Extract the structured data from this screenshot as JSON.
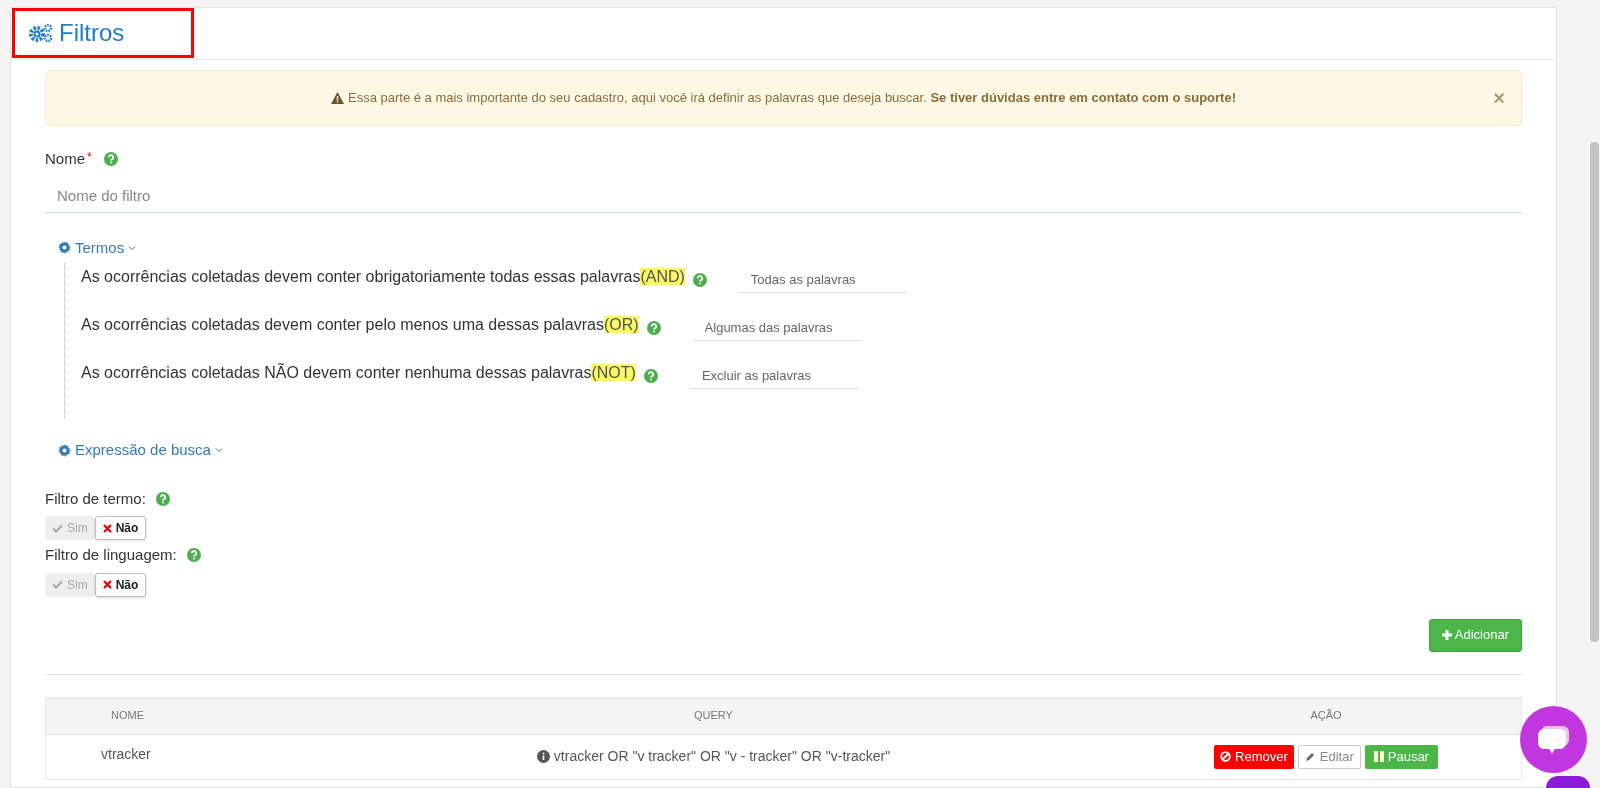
{
  "panel": {
    "title": "Filtros",
    "title_highlighted": true
  },
  "alert": {
    "text": "Essa parte é a mais importante do seu cadastro, aqui você irá definir as palavras que deseja buscar. **Se tiver dúvidas entre em contato com o suporte!**",
    "close": "×"
  },
  "name_field": {
    "label": "Nome",
    "required": "*",
    "placeholder": "Nome do filtro"
  },
  "terms_section": {
    "label": "Termos",
    "expanded": true,
    "rows": [
      {
        "label": "As ocorrências coletadas devem conter obrigatoriamente todas essas palavras",
        "operator": "(AND)",
        "highlighted": true,
        "placeholder": "Todas as palavras"
      },
      {
        "label": "As ocorrências coletadas devem conter pelo menos uma dessas palavras",
        "operator": "(OR)",
        "highlighted": true,
        "placeholder": "Algumas das palavras"
      },
      {
        "label": "As ocorrências coletadas NÃO devem conter nenhuma dessas palavras",
        "operator": "(NOT)",
        "highlighted": true,
        "placeholder": "Excluir as palavras"
      }
    ]
  },
  "expression_section": {
    "label": "Expressão de busca"
  },
  "toggles": [
    {
      "label": "Filtro de termo:",
      "options": [
        {
          "label": "Sim",
          "selected": false
        },
        {
          "label": "Não",
          "selected": true
        }
      ]
    },
    {
      "label": "Filtro de linguagem:",
      "options": [
        {
          "label": "Sim",
          "selected": false
        },
        {
          "label": "Não",
          "selected": true
        }
      ]
    }
  ],
  "add_button": "Adicionar",
  "table": {
    "columns": [
      "NOME",
      "QUERY",
      "AÇÃO"
    ],
    "rows": [
      {
        "name": "vtracker",
        "query": "vtracker OR \"v tracker\" OR \"v - tracker\" OR \"v-tracker\"",
        "actions": [
          {
            "kind": "remove",
            "label": "Remover"
          },
          {
            "kind": "edit",
            "label": "Editar"
          },
          {
            "kind": "pause",
            "label": "Pausar"
          }
        ]
      }
    ]
  }
}
